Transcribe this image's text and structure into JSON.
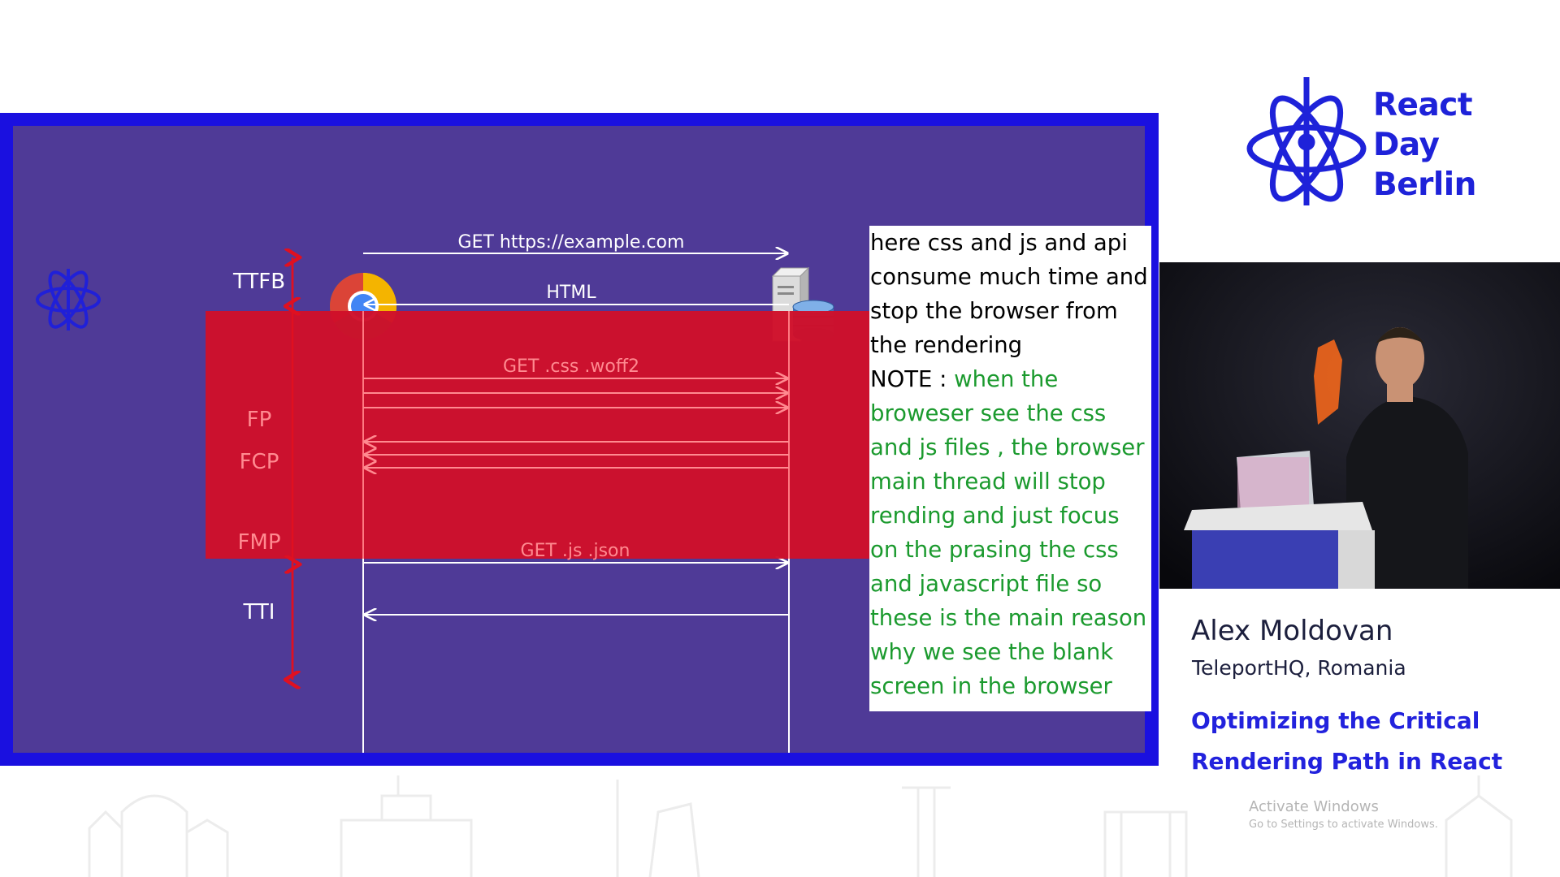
{
  "diagram": {
    "labels": {
      "get_request": "GET https://example.com",
      "html": "HTML",
      "get_css": "GET .css .woff2",
      "get_js": "GET .js .json",
      "ttfb": "TTFB",
      "fp": "FP",
      "fcp": "FCP",
      "fmp": "FMP",
      "tti": "TTI"
    },
    "colors": {
      "slide_bg": "#4f3a97",
      "frame": "#1a10e0",
      "highlight": "#d0102a",
      "marker": "#e01020"
    }
  },
  "note": {
    "black_text": "here css and js and api consume much time and stop the browser from the rendering",
    "note_label": "NOTE : ",
    "green_text": "when the broweser see the css and js files , the browser main thread will stop rending and just focus on the prasing the css and javascript file so these is the main reason why we see the blank screen in the browser"
  },
  "event": {
    "logo_line1": "React",
    "logo_line2": "Day",
    "logo_line3": "Berlin",
    "speaker_name": "Alex Moldovan",
    "speaker_org": "TeleportHQ, Romania",
    "talk_title": "Optimizing the Critical Rendering Path in React"
  },
  "system": {
    "activate_title": "Activate Windows",
    "activate_sub": "Go to Settings to activate Windows."
  }
}
